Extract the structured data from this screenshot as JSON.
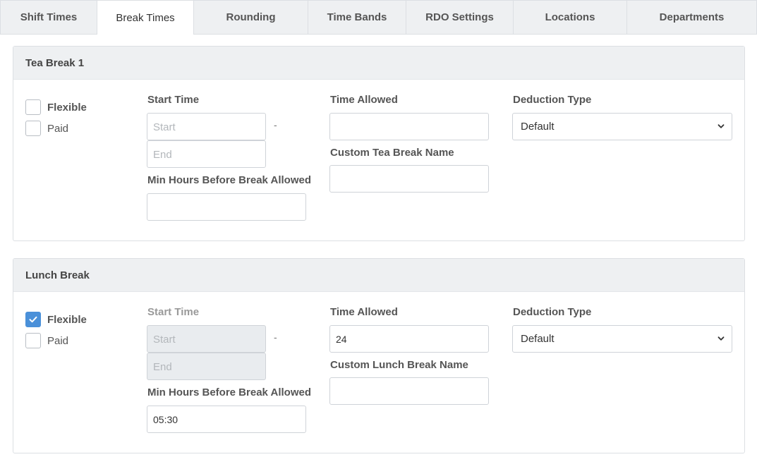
{
  "tabs": [
    {
      "label": "Shift Times"
    },
    {
      "label": "Break Times",
      "active": true
    },
    {
      "label": "Rounding"
    },
    {
      "label": "Time Bands"
    },
    {
      "label": "RDO Settings"
    },
    {
      "label": "Locations"
    },
    {
      "label": "Departments"
    }
  ],
  "tea_break": {
    "title": "Tea Break 1",
    "flexible_label": "Flexible",
    "flexible_checked": false,
    "paid_label": "Paid",
    "paid_checked": false,
    "start_time_label": "Start Time",
    "start_placeholder": "Start",
    "start_value": "",
    "end_placeholder": "End",
    "end_value": "",
    "separator": "-",
    "min_hours_label": "Min Hours Before Break Allowed",
    "min_hours_value": "",
    "time_allowed_label": "Time Allowed",
    "time_allowed_value": "",
    "custom_name_label": "Custom Tea Break Name",
    "custom_name_value": "",
    "deduction_label": "Deduction Type",
    "deduction_value": "Default"
  },
  "lunch_break": {
    "title": "Lunch Break",
    "flexible_label": "Flexible",
    "flexible_checked": true,
    "paid_label": "Paid",
    "paid_checked": false,
    "start_time_label": "Start Time",
    "start_placeholder": "Start",
    "start_value": "",
    "end_placeholder": "End",
    "end_value": "",
    "separator": "-",
    "min_hours_label": "Min Hours Before Break Allowed",
    "min_hours_value": "05:30",
    "time_allowed_label": "Time Allowed",
    "time_allowed_value": "24",
    "custom_name_label": "Custom Lunch Break Name",
    "custom_name_value": "",
    "deduction_label": "Deduction Type",
    "deduction_value": "Default"
  },
  "colors": {
    "accent": "#4a90d9",
    "panel_header_bg": "#eef0f2",
    "disabled_input_bg": "#e9ecef"
  }
}
